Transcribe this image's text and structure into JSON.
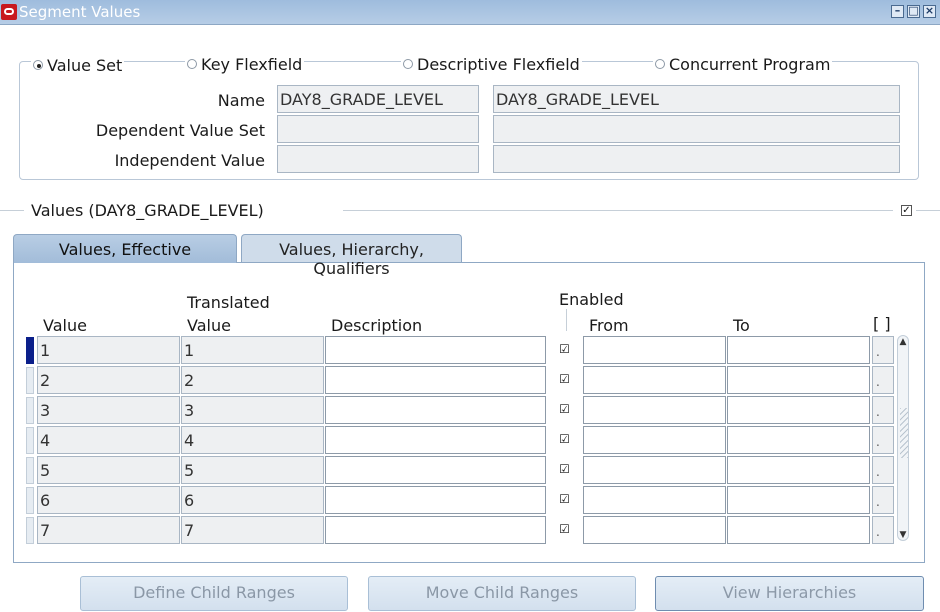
{
  "window": {
    "title": "Segment Values",
    "controls": [
      "minimize",
      "maximize",
      "close"
    ]
  },
  "source_selector": {
    "options": [
      {
        "label": "Value Set",
        "selected": true
      },
      {
        "label": "Key Flexfield",
        "selected": false
      },
      {
        "label": "Descriptive Flexfield",
        "selected": false
      },
      {
        "label": "Concurrent Program",
        "selected": false
      }
    ]
  },
  "header_fields": {
    "name_label": "Name",
    "name_value": "DAY8_GRADE_LEVEL",
    "name_description": "DAY8_GRADE_LEVEL",
    "dependent_label": "Dependent Value Set",
    "dependent_value": "",
    "dependent_description": "",
    "independent_label": "Independent Value",
    "independent_value": "",
    "independent_description": ""
  },
  "values_section": {
    "title": "Values (DAY8_GRADE_LEVEL)",
    "checkbox_checked": true
  },
  "tabs": [
    {
      "label": "Values, Effective",
      "active": true
    },
    {
      "label": "Values, Hierarchy, Qualifiers",
      "active": false
    }
  ],
  "columns": {
    "value": "Value",
    "translated_top": "Translated",
    "translated_bottom": "Value",
    "description": "Description",
    "enabled": "Enabled",
    "from": "From",
    "to": "To",
    "dff": "[ ]"
  },
  "rows": [
    {
      "value": "1",
      "translated": "1",
      "description": "",
      "enabled": true,
      "from": "",
      "to": "",
      "dff": "."
    },
    {
      "value": "2",
      "translated": "2",
      "description": "",
      "enabled": true,
      "from": "",
      "to": "",
      "dff": "."
    },
    {
      "value": "3",
      "translated": "3",
      "description": "",
      "enabled": true,
      "from": "",
      "to": "",
      "dff": "."
    },
    {
      "value": "4",
      "translated": "4",
      "description": "",
      "enabled": true,
      "from": "",
      "to": "",
      "dff": "."
    },
    {
      "value": "5",
      "translated": "5",
      "description": "",
      "enabled": true,
      "from": "",
      "to": "",
      "dff": "."
    },
    {
      "value": "6",
      "translated": "6",
      "description": "",
      "enabled": true,
      "from": "",
      "to": "",
      "dff": "."
    },
    {
      "value": "7",
      "translated": "7",
      "description": "",
      "enabled": true,
      "from": "",
      "to": "",
      "dff": "."
    }
  ],
  "buttons": {
    "define_child_ranges": "Define Child Ranges",
    "move_child_ranges": "Move Child Ranges",
    "view_hierarchies": "View Hierarchies"
  },
  "colors": {
    "title_bar": "#9ebcdd",
    "active_tab": "#a2bcd9",
    "current_row_indicator": "#0b1f8a",
    "readonly_field": "#eef0f2"
  }
}
